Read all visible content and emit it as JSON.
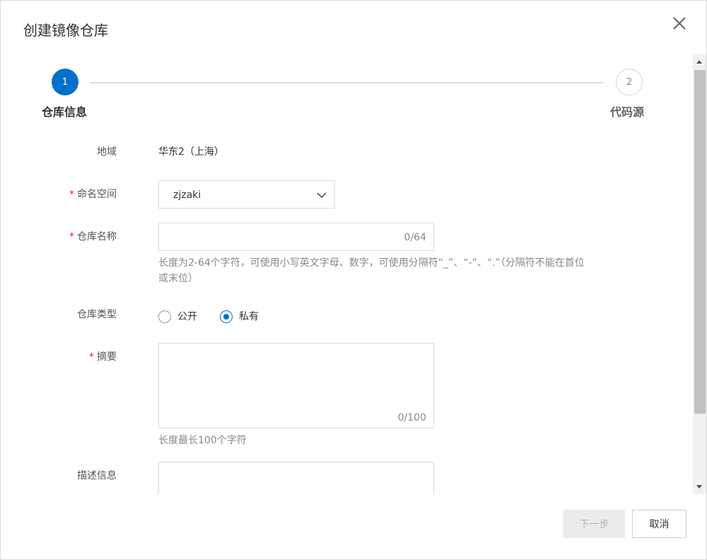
{
  "dialog": {
    "title": "创建镜像仓库"
  },
  "steps": [
    {
      "number": "1",
      "label": "仓库信息",
      "state": "active"
    },
    {
      "number": "2",
      "label": "代码源",
      "state": "pending"
    }
  ],
  "form": {
    "region": {
      "label": "地域",
      "value": "华东2（上海）"
    },
    "namespace": {
      "label": "命名空间",
      "value": "zjzaki",
      "required_mark": "*"
    },
    "repo_name": {
      "label": "仓库名称",
      "required_mark": "*",
      "value": "",
      "counter": "0/64",
      "help_line1": "长度为2-64个字符，可使用小写英文字母、数字，可使用分隔符“_”、“-”、“.”（分隔符不能在首位",
      "help_line2": "或末位）"
    },
    "repo_type": {
      "label": "仓库类型",
      "options": [
        {
          "label": "公开",
          "checked": false
        },
        {
          "label": "私有",
          "checked": true
        }
      ]
    },
    "summary": {
      "label": "摘要",
      "required_mark": "*",
      "value": "",
      "counter": "0/100",
      "help": "长度最长100个字符"
    },
    "description": {
      "label": "描述信息",
      "value": ""
    }
  },
  "footer": {
    "next_label": "下一步",
    "cancel_label": "取消"
  },
  "colors": {
    "primary": "#0070cc",
    "required": "#d93026",
    "disabled_bg": "#ebebeb"
  },
  "icons": {
    "close": "close-icon",
    "dropdown": "chevron-down-icon"
  }
}
